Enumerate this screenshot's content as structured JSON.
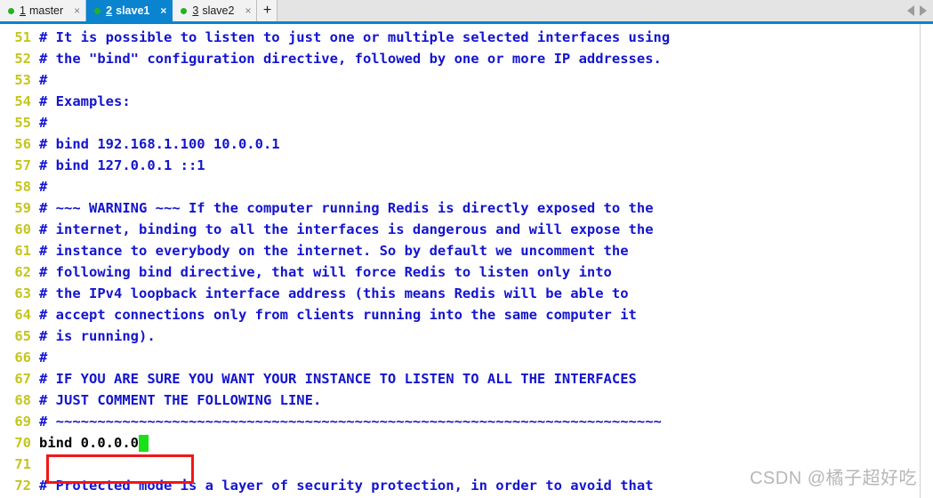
{
  "tabbar": {
    "tabs": [
      {
        "number": "1",
        "label": "master",
        "status_dot_color": "#22b222",
        "close_label": "×",
        "active": false
      },
      {
        "number": "2",
        "label": "slave1",
        "status_dot_color": "#22b222",
        "close_label": "×",
        "active": true
      },
      {
        "number": "3",
        "label": "slave2",
        "status_dot_color": "#22b222",
        "close_label": "×",
        "active": false
      }
    ],
    "new_tab_label": "+",
    "nav_prev_icon": "chevron-left-icon",
    "nav_next_icon": "chevron-right-icon"
  },
  "editor": {
    "first_line_number": 51,
    "lines": [
      {
        "num": "51",
        "text": "# It is possible to listen to just one or multiple selected interfaces using"
      },
      {
        "num": "52",
        "text": "# the \"bind\" configuration directive, followed by one or more IP addresses."
      },
      {
        "num": "53",
        "text": "#"
      },
      {
        "num": "54",
        "text": "# Examples:"
      },
      {
        "num": "55",
        "text": "#"
      },
      {
        "num": "56",
        "text": "# bind 192.168.1.100 10.0.0.1"
      },
      {
        "num": "57",
        "text": "# bind 127.0.0.1 ::1"
      },
      {
        "num": "58",
        "text": "#"
      },
      {
        "num": "59",
        "text": "# ~~~ WARNING ~~~ If the computer running Redis is directly exposed to the"
      },
      {
        "num": "60",
        "text": "# internet, binding to all the interfaces is dangerous and will expose the"
      },
      {
        "num": "61",
        "text": "# instance to everybody on the internet. So by default we uncomment the"
      },
      {
        "num": "62",
        "text": "# following bind directive, that will force Redis to listen only into"
      },
      {
        "num": "63",
        "text": "# the IPv4 loopback interface address (this means Redis will be able to"
      },
      {
        "num": "64",
        "text": "# accept connections only from clients running into the same computer it"
      },
      {
        "num": "65",
        "text": "# is running)."
      },
      {
        "num": "66",
        "text": "#"
      },
      {
        "num": "67",
        "text": "# IF YOU ARE SURE YOU WANT YOUR INSTANCE TO LISTEN TO ALL THE INTERFACES"
      },
      {
        "num": "68",
        "text": "# JUST COMMENT THE FOLLOWING LINE."
      },
      {
        "num": "69",
        "text": "# ~~~~~~~~~~~~~~~~~~~~~~~~~~~~~~~~~~~~~~~~~~~~~~~~~~~~~~~~~~~~~~~~~~~~~~~~~"
      },
      {
        "num": "70",
        "text": "bind 0.0.0.0",
        "marked": true,
        "cursor": true
      },
      {
        "num": "71",
        "text": ""
      },
      {
        "num": "72",
        "text": "# Protected mode is a layer of security protection, in order to avoid that"
      }
    ],
    "annotation_box_color": "#f31616",
    "cursor_color": "#19e019",
    "comment_color": "#1414cf",
    "line_number_color": "#c5c51f"
  },
  "watermark": {
    "text": "CSDN @橘子超好吃"
  }
}
